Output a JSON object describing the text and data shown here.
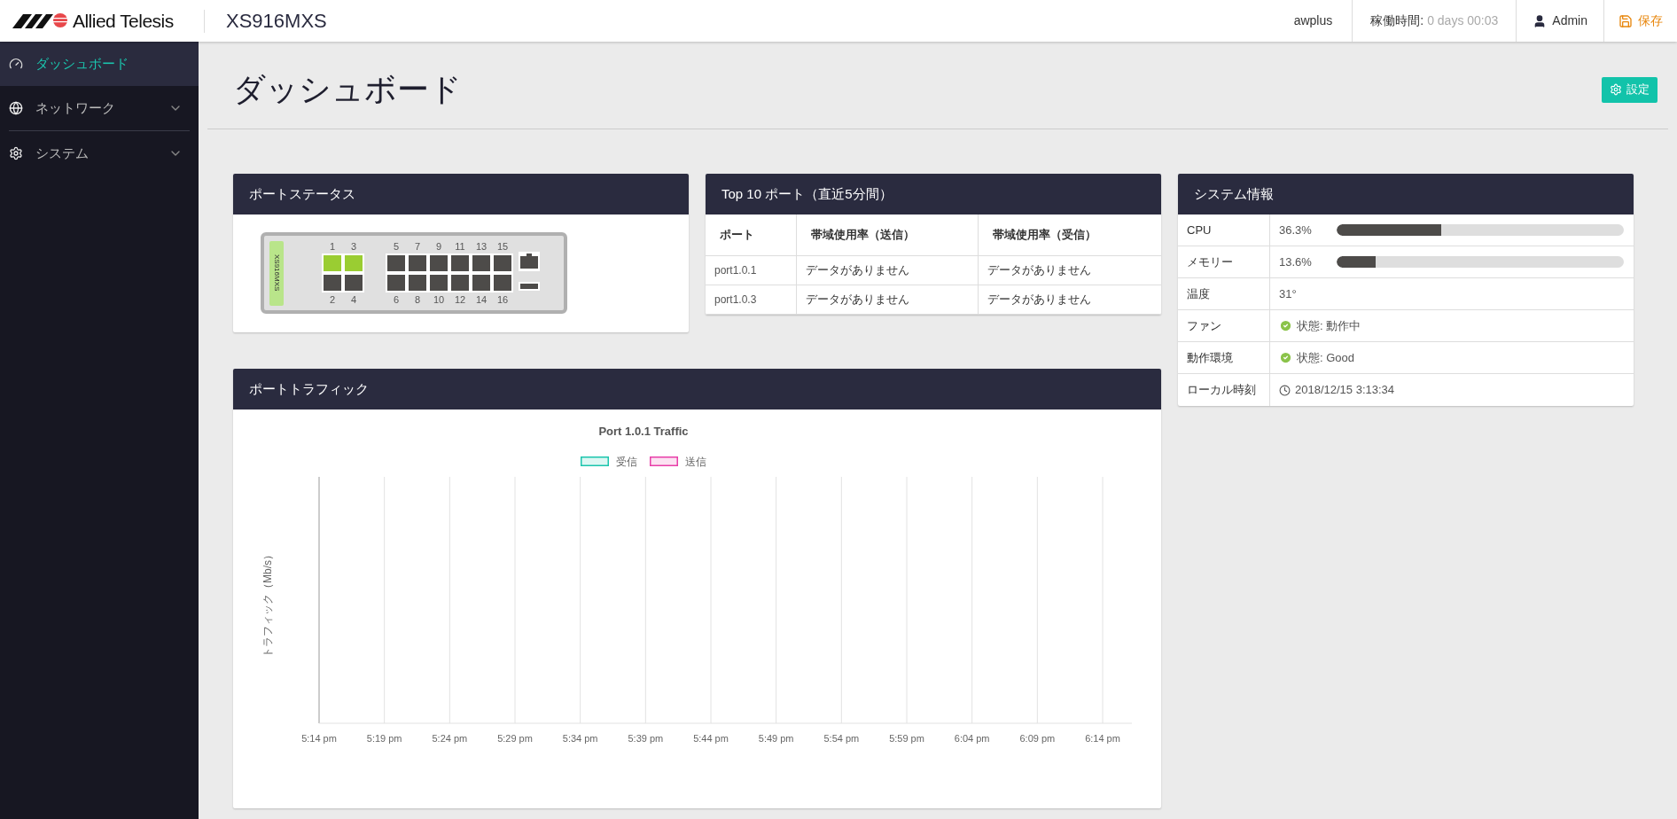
{
  "header": {
    "brand": "Allied Telesis",
    "model": "XS916MXS",
    "hostname": "awplus",
    "uptime_label": "稼働時間:",
    "uptime_value": "0 days 00:03",
    "user": "Admin",
    "save": "保存"
  },
  "sidebar": {
    "items": [
      {
        "label": "ダッシュボード",
        "kind": "link",
        "selected": true
      },
      {
        "label": "ネットワーク",
        "kind": "group",
        "selected": false,
        "expanded": false
      },
      {
        "label": "システム",
        "kind": "group",
        "selected": false,
        "expanded": false
      }
    ]
  },
  "page": {
    "title": "ダッシュボード",
    "settings_button": "設定"
  },
  "port_status": {
    "title": "ポートステータス",
    "device_label": "XS916MXS",
    "port_groups": [
      {
        "ports": [
          {
            "label": "1",
            "up": true
          },
          {
            "label": "2",
            "up": false
          },
          {
            "label": "3",
            "up": true
          },
          {
            "label": "4",
            "up": false
          }
        ]
      },
      {
        "ports": [
          {
            "label": "5",
            "up": false
          },
          {
            "label": "6",
            "up": false
          },
          {
            "label": "7",
            "up": false
          },
          {
            "label": "8",
            "up": false
          },
          {
            "label": "9",
            "up": false
          },
          {
            "label": "10",
            "up": false
          },
          {
            "label": "11",
            "up": false
          },
          {
            "label": "12",
            "up": false
          },
          {
            "label": "13",
            "up": false
          },
          {
            "label": "14",
            "up": false
          },
          {
            "label": "15",
            "up": false
          },
          {
            "label": "16",
            "up": false
          }
        ]
      }
    ]
  },
  "top_ports": {
    "title": "Top 10 ポート（直近5分間）",
    "columns": [
      "ポート",
      "帯域使用率（送信）",
      "帯域使用率（受信）"
    ],
    "rows": [
      [
        "port1.0.1",
        "データがありません",
        "データがありません"
      ],
      [
        "port1.0.3",
        "データがありません",
        "データがありません"
      ]
    ]
  },
  "system_info": {
    "title": "システム情報",
    "rows": [
      {
        "kind": "bar",
        "label": "CPU",
        "value": "36.3%",
        "level": 0.363
      },
      {
        "kind": "bar",
        "label": "メモリー",
        "value": "13.6%",
        "level": 0.136
      },
      {
        "kind": "text",
        "label": "温度",
        "value": "31°"
      },
      {
        "kind": "status",
        "label": "ファン",
        "value": "状態: 動作中"
      },
      {
        "kind": "status",
        "label": "動作環境",
        "value": "状態: Good"
      },
      {
        "kind": "clock",
        "label": "ローカル時刻",
        "value": "2018/12/15 3:13:34"
      }
    ]
  },
  "port_traffic": {
    "title": "ポートトラフィック",
    "chart": {
      "title": "Port 1.0.1 Traffic",
      "y_label": "トラフィック（Mb/s）",
      "x_labels": [
        "5:14 pm",
        "5:19 pm",
        "5:24 pm",
        "5:29 pm",
        "5:34 pm",
        "5:39 pm",
        "5:44 pm",
        "5:49 pm",
        "5:54 pm",
        "5:59 pm",
        "6:04 pm",
        "6:09 pm",
        "6:14 pm"
      ],
      "legend": [
        {
          "label": "受信",
          "color": "#1bc5ad"
        },
        {
          "label": "送信",
          "color": "#e83ea8"
        }
      ]
    }
  }
}
